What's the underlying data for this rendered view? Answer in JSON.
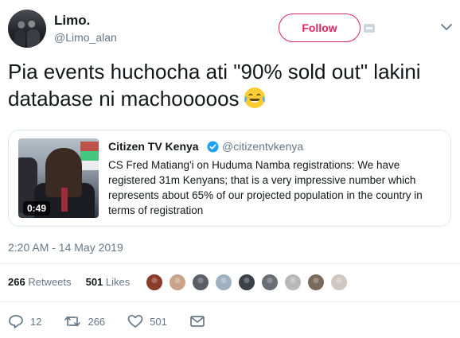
{
  "author": {
    "display_name": "Limo.",
    "handle": "@Limo_alan"
  },
  "follow_label": "Follow",
  "tweet": {
    "text": "Pia events huchocha ati \"90% sold out\" lakini database ni machooooos",
    "emoji": "face-with-tears-of-joy"
  },
  "quote": {
    "display_name": "Citizen TV Kenya",
    "handle": "@citizentvkenya",
    "text": "CS Fred Matiang'i on Huduma Namba registrations: We have registered 31m Kenyans; that is a very impressive number which represents about 65% of our projected population in the country in terms of registration",
    "video_duration": "0:49"
  },
  "timestamp": "2:20 AM - 14 May 2019",
  "stats": {
    "retweets_count": "266",
    "retweets_label": "Retweets",
    "likes_count": "501",
    "likes_label": "Likes"
  },
  "likers_colors": [
    "#8a3b2a",
    "#c9a48a",
    "#5a5e66",
    "#9fb0c0",
    "#3c4148",
    "#6a6f75",
    "#b8b8b8",
    "#7a6a5a",
    "#d0c7c0"
  ],
  "actions": {
    "replies": "12",
    "retweets": "266",
    "likes": "501"
  },
  "colors": {
    "accent": "#e0245e",
    "muted": "#657786",
    "verified": "#1da1f2"
  }
}
